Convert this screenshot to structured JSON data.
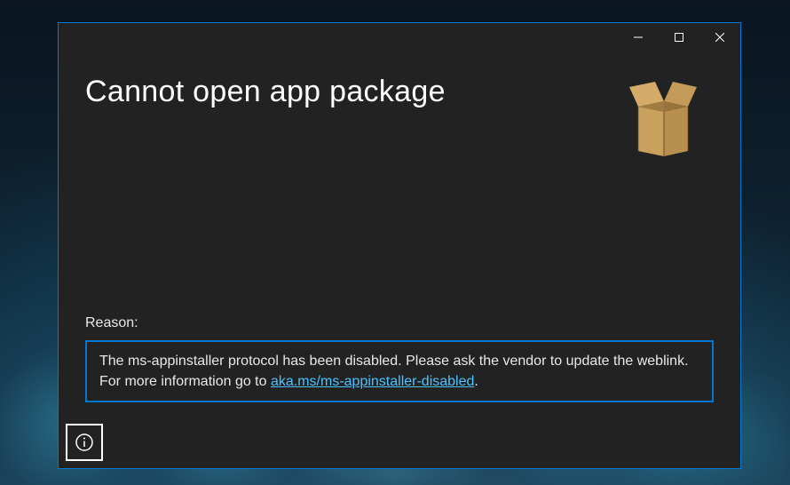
{
  "window": {
    "title": "Cannot open app package"
  },
  "reason": {
    "label": "Reason:",
    "text_before": "The ms-appinstaller protocol has been disabled. Please ask the vendor to update the weblink. For more information go to ",
    "link_text": "aka.ms/ms-appinstaller-disabled",
    "text_after": "."
  }
}
